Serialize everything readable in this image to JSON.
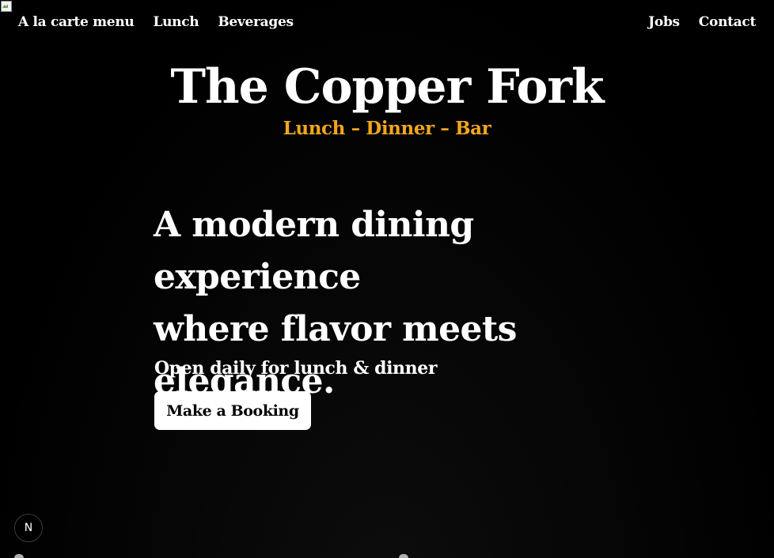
{
  "nav": {
    "left": [
      "A la carte menu",
      "Lunch",
      "Beverages"
    ],
    "right": [
      "Jobs",
      "Contact"
    ]
  },
  "brand": {
    "title": "The Copper Fork",
    "subtitle": "Lunch – Dinner – Bar"
  },
  "hero": {
    "headline": "A modern dining experience\nwhere flavor meets elegance.",
    "hours": "Open daily for lunch & dinner",
    "cta_label": "Make a Booking"
  },
  "dev_badge": {
    "label": "N"
  },
  "colors": {
    "background": "#000000",
    "text": "#ffffff",
    "accent": "#f2a61f",
    "button_bg": "#ffffff",
    "button_text": "#000000"
  },
  "icons": {
    "broken_image": "broken-image-icon"
  }
}
